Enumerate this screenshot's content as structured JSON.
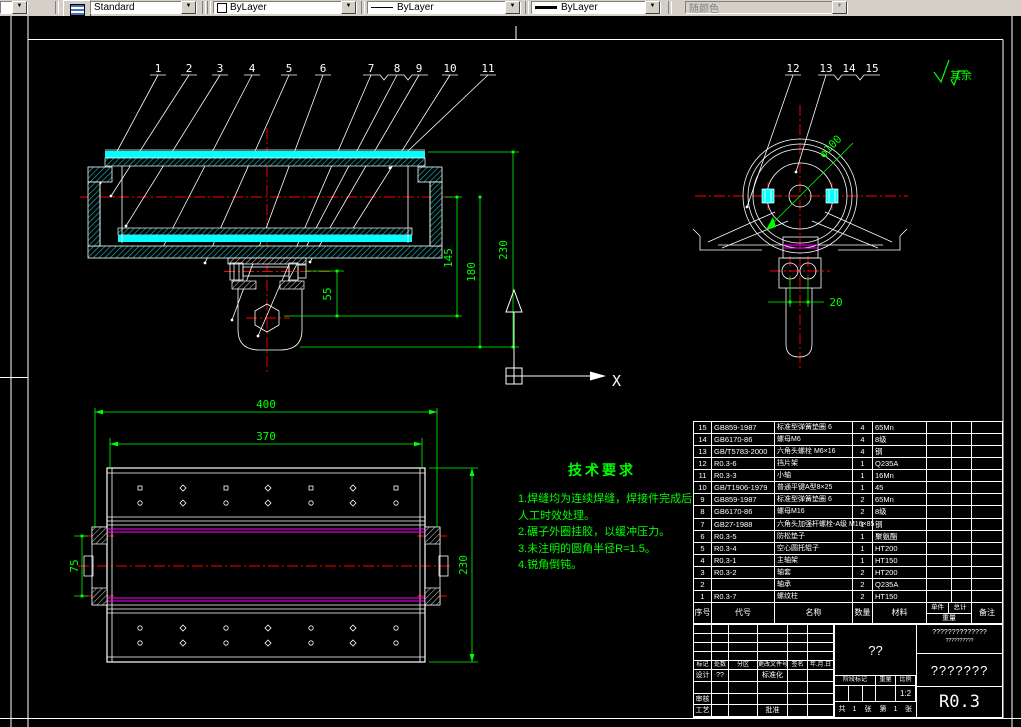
{
  "toolbar": {
    "style_combo": "Standard",
    "color_combo": "ByLayer",
    "linetype_combo": "ByLayer",
    "lineweight_combo": "ByLayer",
    "plotstyle_combo": "随颜色"
  },
  "drawing": {
    "callouts": [
      "1",
      "2",
      "3",
      "4",
      "5",
      "6",
      "7",
      "8",
      "9",
      "10",
      "11",
      "12",
      "13",
      "14",
      "15"
    ],
    "dims": {
      "d55": "55",
      "d145": "145",
      "d180": "180",
      "d230a": "230",
      "d400": "400",
      "d370": "370",
      "d230b": "230",
      "d75": "75",
      "phi": "φ100",
      "d20": "20"
    },
    "axis_x": "X",
    "surface": "其余",
    "tech": {
      "title": "技术要求",
      "lines": [
        "1.焊缝均为连续焊缝，焊接件完成后",
        "人工时效处理。",
        "2.碾子外圈挂胶，以缓冲压力。",
        "3.未注明的圆角半径R=1.5。",
        "4.锐角倒钝。"
      ]
    }
  },
  "bom": {
    "headers": {
      "seq": "序号",
      "code": "代号",
      "name": "名称",
      "qty": "数量",
      "material": "材料",
      "unit": "单件",
      "total": "总计",
      "weight": "重量",
      "remark": "备注"
    },
    "rows": [
      {
        "seq": "15",
        "code": "GB859-1987",
        "name": "标准型弹簧垫圈 6",
        "qty": "4",
        "material": "65Mn"
      },
      {
        "seq": "14",
        "code": "GB6170-86",
        "name": "螺母M6",
        "qty": "4",
        "material": "8级"
      },
      {
        "seq": "13",
        "code": "GB/T5783-2000",
        "name": "六角头螺栓 M6×16",
        "qty": "4",
        "material": "钢"
      },
      {
        "seq": "12",
        "code": "R0.3-6",
        "name": "挡片架",
        "qty": "1",
        "material": "Q235A"
      },
      {
        "seq": "11",
        "code": "R0.3-3",
        "name": "小轴",
        "qty": "1",
        "material": "16Mn"
      },
      {
        "seq": "10",
        "code": "GB/T1906-1979",
        "name": "普通平键A型8×25",
        "qty": "1",
        "material": "45"
      },
      {
        "seq": "9",
        "code": "GB859-1987",
        "name": "标准型弹簧垫圈 6",
        "qty": "2",
        "material": "65Mn"
      },
      {
        "seq": "8",
        "code": "GB6170-86",
        "name": "螺母M16",
        "qty": "2",
        "material": "8级"
      },
      {
        "seq": "7",
        "code": "GB27-1988",
        "name": "六角头加强杆螺栓-A级 M16×85",
        "qty": "1",
        "material": "钢"
      },
      {
        "seq": "6",
        "code": "R0.3-5",
        "name": "防松垫子",
        "qty": "1",
        "material": "聚氨酯"
      },
      {
        "seq": "5",
        "code": "R0.3-4",
        "name": "空心圆托辊子",
        "qty": "1",
        "material": "HT200"
      },
      {
        "seq": "4",
        "code": "R0.3-1",
        "name": "主轴架",
        "qty": "1",
        "material": "HT150"
      },
      {
        "seq": "3",
        "code": "R0.3-2",
        "name": "轴套",
        "qty": "2",
        "material": "HT200"
      },
      {
        "seq": "2",
        "code": "",
        "name": "轴承",
        "qty": "2",
        "material": "Q235A"
      },
      {
        "seq": "1",
        "code": "R0.3-7",
        "name": "螺纹柱",
        "qty": "2",
        "material": "HT150"
      }
    ]
  },
  "titleblock": {
    "record_headers": [
      "标记",
      "处数",
      "分区",
      "更改文件号",
      "签名",
      "年.月.日"
    ],
    "design_label": "设计",
    "design_name": "??",
    "standardization_label": "标准化",
    "audit_label": "审核",
    "craft_label": "工艺",
    "approve_label": "批准",
    "title_text": "??",
    "stage_label": "阶段标记",
    "weight_label": "重量",
    "scale_label": "比例",
    "scale_value": "1:2",
    "sheet_cells": [
      "共",
      "1",
      "张",
      "第",
      "1",
      "张"
    ],
    "company_line1": "??????????????",
    "company_line2": "??????????",
    "drawing_no": "???????",
    "code": "R0.3"
  }
}
